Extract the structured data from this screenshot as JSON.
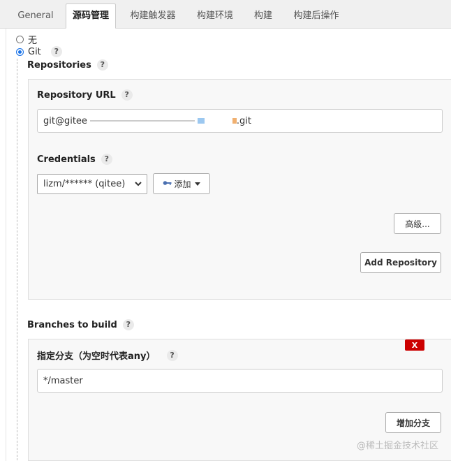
{
  "tabs": [
    "General",
    "源码管理",
    "构建触发器",
    "构建环境",
    "构建",
    "构建后操作"
  ],
  "scm": {
    "option_none": "无",
    "option_git": "Git",
    "help": "?"
  },
  "repositories": {
    "title": "Repositories",
    "url_label": "Repository URL",
    "url_value_prefix": "git@gitee",
    "url_value_suffix": ".git",
    "credentials_label": "Credentials",
    "credentials_value": "lizm/****** (qitee)",
    "add_button": "添加",
    "advanced_button": "高级...",
    "add_repository_button": "Add Repository"
  },
  "branches": {
    "title": "Branches to build",
    "branch_label": "指定分支（为空时代表any）",
    "branch_value": "*/master",
    "delete_label": "X",
    "add_branch_button": "增加分支"
  },
  "watermark": "@稀土掘金技术社区",
  "colors": {
    "delete": "#cc0000",
    "radio_checked": "#1a73e8"
  },
  "icons": {
    "add_key": "key-icon",
    "dropdown": "chevron-down-icon"
  }
}
